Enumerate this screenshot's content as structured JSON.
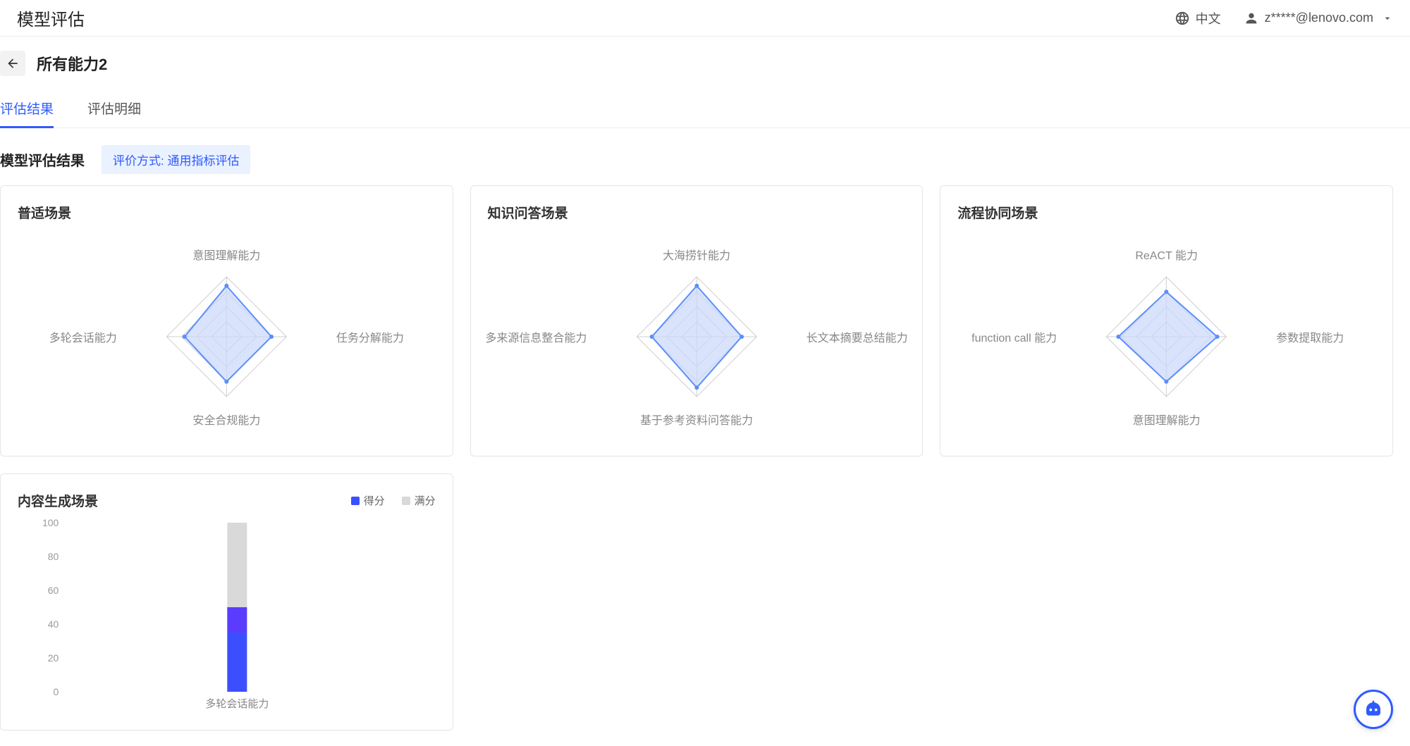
{
  "topbar": {
    "title": "模型评估",
    "language": "中文",
    "user_email": "z*****@lenovo.com"
  },
  "page": {
    "title": "所有能力2"
  },
  "tabs": [
    {
      "label": "评估结果",
      "active": true
    },
    {
      "label": "评估明细",
      "active": false
    }
  ],
  "section": {
    "title": "模型评估结果",
    "eval_method_label": "评价方式: 通用指标评估"
  },
  "radar_cards": [
    {
      "title": "普适场景",
      "axes": [
        "意图理解能力",
        "任务分解能力",
        "安全合规能力",
        "多轮会话能力"
      ]
    },
    {
      "title": "知识问答场景",
      "axes": [
        "大海捞针能力",
        "长文本摘要总结能力",
        "基于参考资料问答能力",
        "多来源信息整合能力"
      ]
    },
    {
      "title": "流程协同场景",
      "axes": [
        "ReACT 能力",
        "参数提取能力",
        "意图理解能力",
        "function call 能力"
      ]
    }
  ],
  "bar_card": {
    "title": "内容生成场景",
    "legend": {
      "score": "得分",
      "full": "满分"
    }
  },
  "chart_data": [
    {
      "type": "radar",
      "title": "普适场景",
      "categories": [
        "意图理解能力",
        "任务分解能力",
        "安全合规能力",
        "多轮会话能力"
      ],
      "series": [
        {
          "name": "score",
          "values": [
            0.85,
            0.75,
            0.75,
            0.7
          ]
        }
      ],
      "range": [
        0,
        1
      ],
      "rings": 4
    },
    {
      "type": "radar",
      "title": "知识问答场景",
      "categories": [
        "大海捞针能力",
        "长文本摘要总结能力",
        "基于参考资料问答能力",
        "多来源信息整合能力"
      ],
      "series": [
        {
          "name": "score",
          "values": [
            0.85,
            0.75,
            0.85,
            0.75
          ]
        }
      ],
      "range": [
        0,
        1
      ],
      "rings": 4
    },
    {
      "type": "radar",
      "title": "流程协同场景",
      "categories": [
        "ReACT 能力",
        "参数提取能力",
        "意图理解能力",
        "function call 能力"
      ],
      "series": [
        {
          "name": "score",
          "values": [
            0.75,
            0.85,
            0.75,
            0.8
          ]
        }
      ],
      "range": [
        0,
        1
      ],
      "rings": 4
    },
    {
      "type": "bar",
      "title": "内容生成场景",
      "categories": [
        "多轮会话能力"
      ],
      "series": [
        {
          "name": "得分",
          "values": [
            50
          ],
          "color": "#3b4fff"
        },
        {
          "name": "满分",
          "values": [
            100
          ],
          "color": "#d9d9d9"
        }
      ],
      "ylim": [
        0,
        100
      ],
      "yticks": [
        0,
        20,
        40,
        60,
        80,
        100
      ],
      "ylabel": "",
      "xlabel": ""
    }
  ],
  "colors": {
    "radar_stroke": "#5b8ff9",
    "radar_fill": "#c9d7fb",
    "radar_grid": "#cfcfcf",
    "bar_score": "#3b4fff",
    "bar_score_top": "#5a3cff",
    "bar_full": "#d9d9d9",
    "accent": "#2e5bff"
  }
}
